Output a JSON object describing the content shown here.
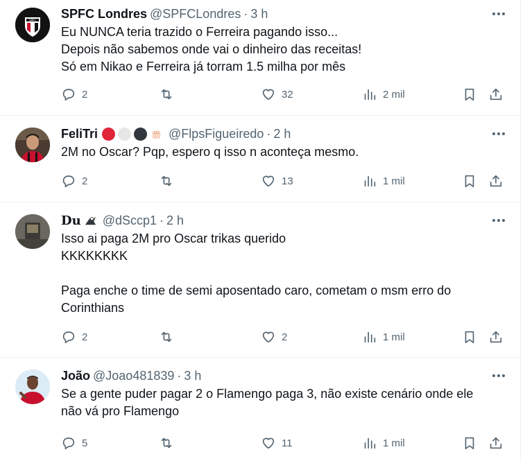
{
  "tweets": [
    {
      "name": "SPFC Londres",
      "handle": "@SPFCLondres",
      "separator": "·",
      "time": "3 h",
      "text": "Eu NUNCA teria trazido o Ferreira pagando isso...\nDepois não sabemos onde vai o dinheiro das receitas!\nSó em Nikao e Ferreira já torram 1.5 milha por mês",
      "replies": "2",
      "retweets": "",
      "likes": "32",
      "views": "2 mil"
    },
    {
      "name": "FeliTri",
      "handle": "@FlpsFigueiredo",
      "separator": "·",
      "time": "2 h",
      "text": "2M no Oscar? Pqp, espero q isso n aconteça mesmo.",
      "replies": "2",
      "retweets": "",
      "likes": "13",
      "views": "1 mil"
    },
    {
      "name": "Du",
      "handle": "@dSccp1",
      "separator": "·",
      "time": "2 h",
      "text": "Isso ai paga 2M pro Oscar trikas querido\nKKKKKKKK\n\nPaga enche o time de semi aposentado caro, cometam o msm erro do\nCorinthians",
      "replies": "2",
      "retweets": "",
      "likes": "2",
      "views": "1 mil"
    },
    {
      "name": "João",
      "handle": "@Joao481839",
      "separator": "·",
      "time": "3 h",
      "text": "Se a gente puder pagar 2 o Flamengo paga 3, não existe cenário onde ele\nnão vá pro Flamengo",
      "replies": "5",
      "retweets": "",
      "likes": "11",
      "views": "1 mil"
    }
  ],
  "icons": {
    "reply": "speech-bubble-icon",
    "retweet": "retweet-arrows-icon",
    "like": "heart-icon",
    "views": "bar-chart-icon",
    "bookmark": "bookmark-icon",
    "share": "share-upload-icon",
    "more": "more-dots-icon"
  },
  "colors": {
    "text": "#0f1419",
    "secondary": "#536471",
    "divider": "#eff3f4"
  }
}
